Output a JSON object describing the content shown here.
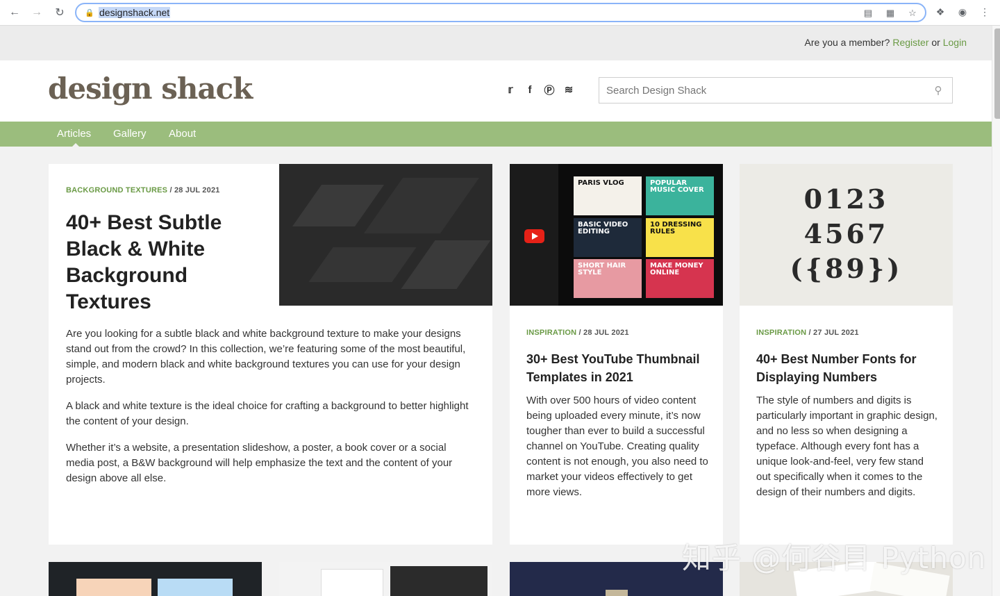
{
  "browser": {
    "url": "designshack.net",
    "icons": [
      "back-icon",
      "forward-icon",
      "reload-icon",
      "lock-icon",
      "cast-icon",
      "qr-icon",
      "star-icon",
      "extensions-icon",
      "profile-icon",
      "menu-icon"
    ]
  },
  "member_bar": {
    "question": "Are you a member?",
    "register": "Register",
    "or": "or",
    "login": "Login"
  },
  "header": {
    "logo": "design shack",
    "search_placeholder": "Search Design Shack"
  },
  "nav": {
    "items": [
      "Articles",
      "Gallery",
      "About"
    ],
    "active": "Articles"
  },
  "colors": {
    "accent_green": "#9bbd7d",
    "link_green": "#6a9a45",
    "logo_brown": "#6b6154"
  },
  "featured": {
    "category": "BACKGROUND TEXTURES",
    "date": "/ 28 JUL 2021",
    "title": "40+ Best Subtle Black & White Background Textures",
    "paragraphs": [
      "Are you looking for a subtle black and white background texture to make your designs stand out from the crowd? In this collection, we’re featuring some of the most beautiful, simple, and modern black and white background textures you can use for your design projects.",
      "A black and white texture is the ideal choice for crafting a background to better highlight the content of your design.",
      "Whether it’s a website, a presentation slideshow, a poster, a book cover or a social media post, a B&W background will help emphasize the text and the content of your design above all else."
    ]
  },
  "card2": {
    "category": "INSPIRATION",
    "date": "/ 28 JUL 2021",
    "title": "30+ Best YouTube Thumbnail Templates in 2021",
    "excerpt": "With over 500 hours of video content being uploaded every minute, it’s now tougher than ever to build a successful channel on YouTube. Creating quality content is not enough, you also need to market your videos effectively to get more views.",
    "thumbs": [
      "PARIS VLOG",
      "POPULAR MUSIC COVER",
      "BASIC VIDEO EDITING",
      "10 DRESSING RULES",
      "SHORT HAIR STYLE",
      "MAKE MONEY ONLINE"
    ]
  },
  "card3": {
    "category": "INSPIRATION",
    "date": "/ 27 JUL 2021",
    "title": "40+ Best Number Fonts for Displaying Numbers",
    "excerpt": "The style of numbers and digits is particularly important in graphic design, and no less so when designing a typeface. Although every font has a unique look-and-feel, very few stand out specifically when it comes to the design of their numbers and digits.",
    "number_lines": [
      "0123",
      "4567",
      "({89})"
    ]
  },
  "watermark": "知乎 @何谷目 Python"
}
